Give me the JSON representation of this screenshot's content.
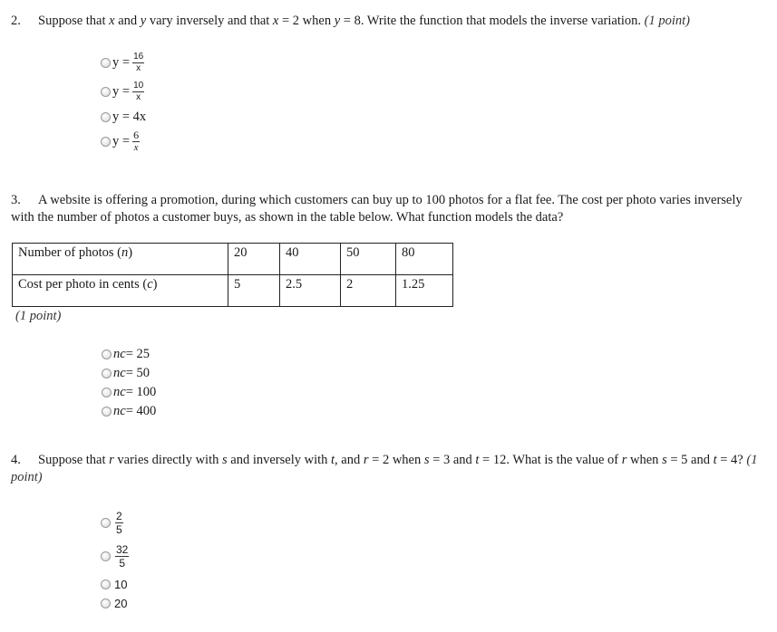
{
  "questions": [
    {
      "number": "2.",
      "text_parts": [
        "Suppose that ",
        "x",
        " and ",
        "y",
        " vary inversely and that ",
        "x",
        " = 2 when ",
        "y",
        " = 8. Write the function that models the inverse variation. "
      ],
      "points": "(1 point)",
      "options": [
        {
          "lhs": "y =",
          "num": "16",
          "den": "x"
        },
        {
          "lhs": "y =",
          "num": "10",
          "den": "x"
        },
        {
          "text": "y = 4x"
        },
        {
          "lhs": "y =",
          "num": "6",
          "den": "x"
        }
      ]
    },
    {
      "number": "3.",
      "text": "A website is offering a promotion, during which customers can buy up to 100 photos for a flat fee. The cost per photo varies inversely with the number of photos a customer buys, as shown in the table below. What function models the data?",
      "table": {
        "rows": [
          {
            "label": "Number of photos",
            "var": "n",
            "values": [
              "20",
              "40",
              "50",
              "80"
            ]
          },
          {
            "label": "Cost per photo in cents",
            "var": "c",
            "values": [
              "5",
              "2.5",
              "2",
              "1.25"
            ]
          }
        ]
      },
      "points": "(1 point)",
      "options": [
        {
          "var": "nc",
          "rest": " = 25"
        },
        {
          "var": "nc",
          "rest": " = 50"
        },
        {
          "var": "nc",
          "rest": " = 100"
        },
        {
          "var": "nc",
          "rest": " = 400"
        }
      ]
    },
    {
      "number": "4.",
      "text_parts": [
        "Suppose that ",
        "r",
        " varies directly with ",
        "s",
        " and inversely with ",
        "t",
        ", and ",
        "r",
        " = 2 when ",
        "s",
        " = 3 and ",
        "t",
        " = 12. What is the value of ",
        "r",
        " when ",
        "s",
        " = 5 and ",
        "t",
        " = 4? "
      ],
      "points": "(1 point)",
      "options": [
        {
          "num": "2",
          "den": "5"
        },
        {
          "num": "32",
          "den": "5"
        },
        {
          "text": "10"
        },
        {
          "text": "20"
        }
      ]
    }
  ]
}
